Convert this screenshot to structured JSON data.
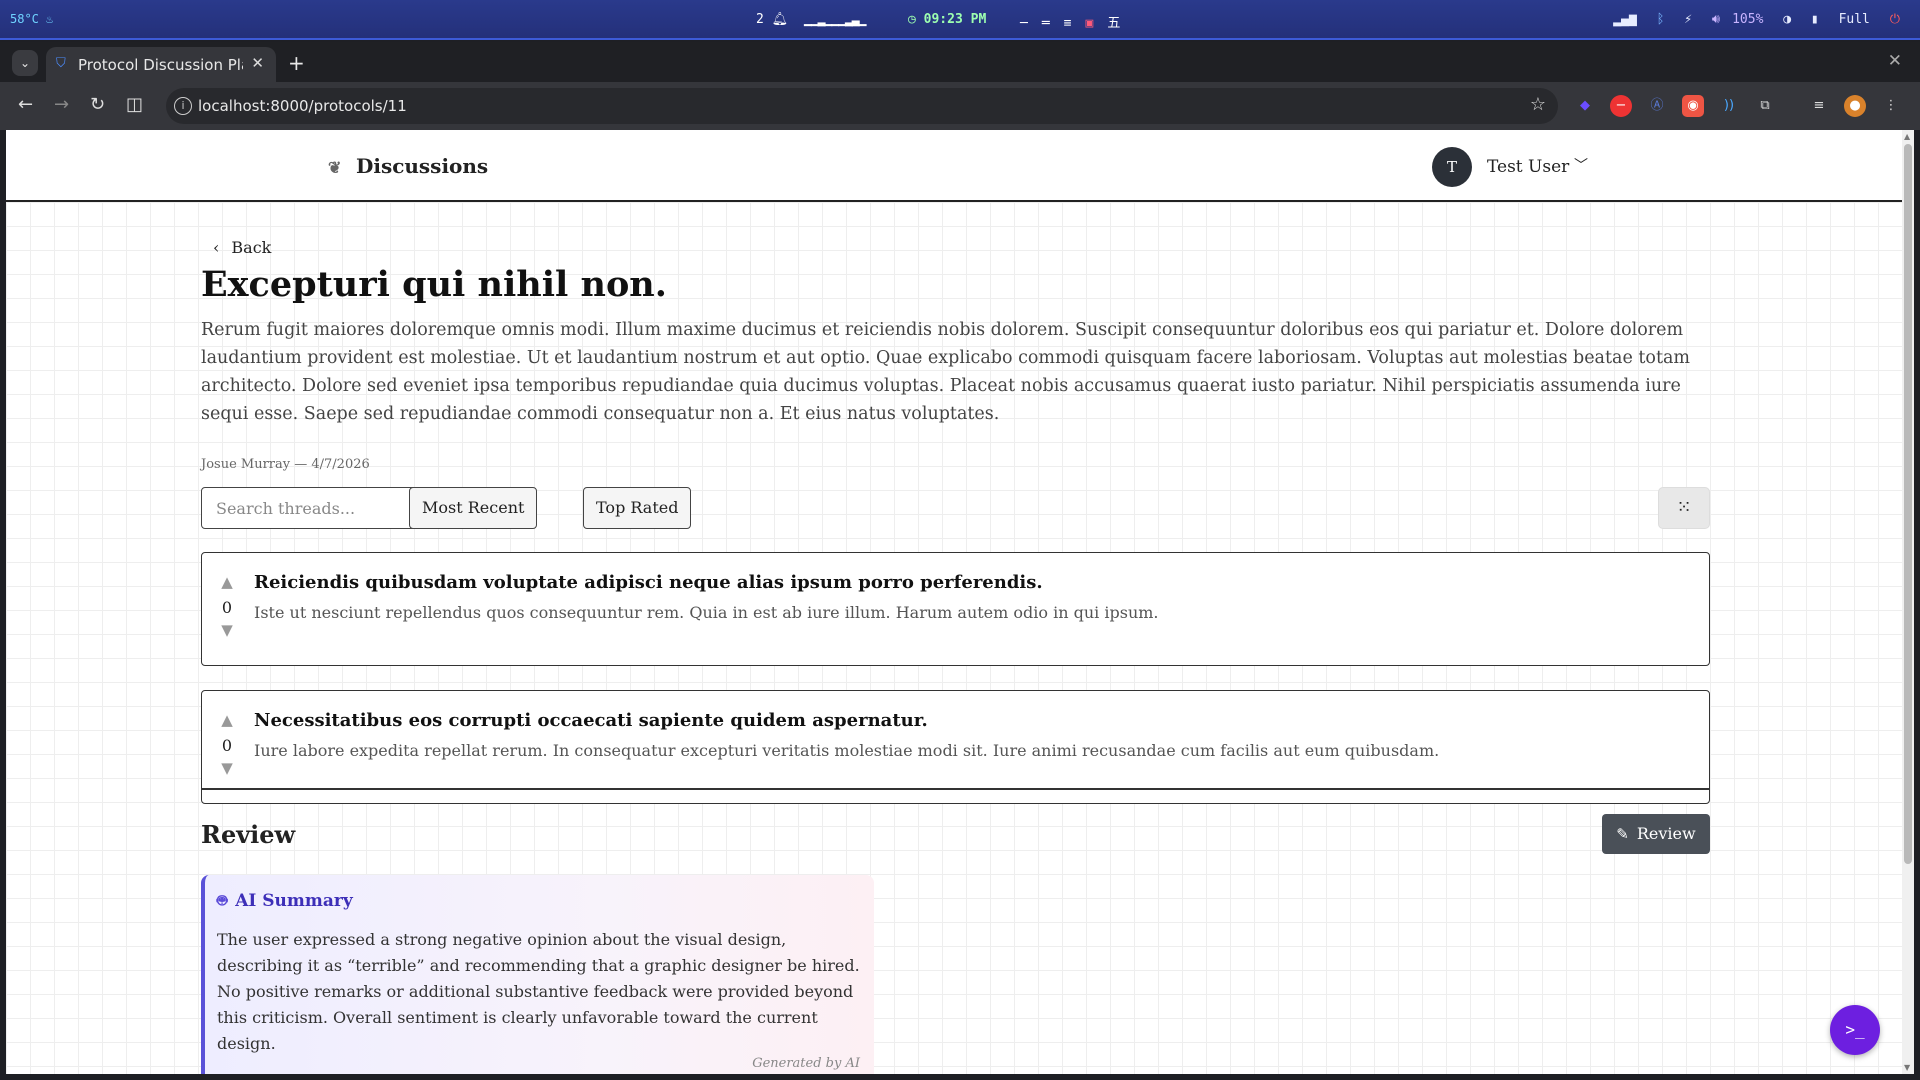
{
  "os": {
    "temperature": "58°C",
    "notifications": "2",
    "clock": "09:23 PM",
    "volume": "105%",
    "battery": "Full"
  },
  "browser": {
    "tab_title": "Protocol Discussion Platform",
    "url": "localhost:8000/protocols/11"
  },
  "navbar": {
    "brand": "Discussions",
    "user_initial": "T",
    "user_name": "Test User"
  },
  "protocol": {
    "back_label": "Back",
    "title": "Excepturi qui nihil non.",
    "body": "Rerum fugit maiores doloremque omnis modi. Illum maxime ducimus et reiciendis nobis dolorem. Suscipit consequuntur doloribus eos qui pariatur et. Dolore dolorem laudantium provident est molestiae. Ut et laudantium nostrum et aut optio. Quae explicabo commodi quisquam facere laboriosam. Voluptas aut molestias beatae totam architecto. Dolore sed eveniet ipsa temporibus repudiandae quia ducimus voluptas. Placeat nobis accusamus quaerat iusto pariatur. Nihil perspiciatis assumenda iure sequi esse. Saepe sed repudiandae commodi consequatur non a. Et eius natus voluptates.",
    "meta": "Josue Murray — 4/7/2026"
  },
  "controls": {
    "search_placeholder": "Search threads...",
    "sort_recent": "Most Recent",
    "sort_top": "Top Rated"
  },
  "threads": [
    {
      "votes": "0",
      "title": "Reiciendis quibusdam voluptate adipisci neque alias ipsum porro perferendis.",
      "body": "Iste ut nesciunt repellendus quos consequuntur rem. Quia in est ab iure illum. Harum autem odio in qui ipsum."
    },
    {
      "votes": "0",
      "title": "Necessitatibus eos corrupti occaecati sapiente quidem aspernatur.",
      "body": "Iure labore expedita repellat rerum. In consequatur excepturi veritatis molestiae modi sit. Iure animi recusandae cum facilis aut eum quibusdam."
    }
  ],
  "review": {
    "heading": "Review",
    "button_label": "Review",
    "ai_title": "AI Summary",
    "ai_text": "The user expressed a strong negative opinion about the visual design, describing it as “terrible” and recommending that a graphic designer be hired. No positive remarks or additional substantive feedback were provided beyond this criticism. Overall sentiment is clearly unfavorable toward the current design.",
    "ai_footer": "Generated by AI"
  },
  "colors": {
    "accent": "#5a52d8",
    "fab": "#6d1fe0",
    "review_button": "#4a5058"
  },
  "icons": {
    "brand": "brand-logo-icon",
    "back": "chevron-left-icon",
    "grid": "grid-dots-icon",
    "review": "pencil-icon",
    "ai": "robot-icon",
    "fab": "terminal-icon"
  }
}
